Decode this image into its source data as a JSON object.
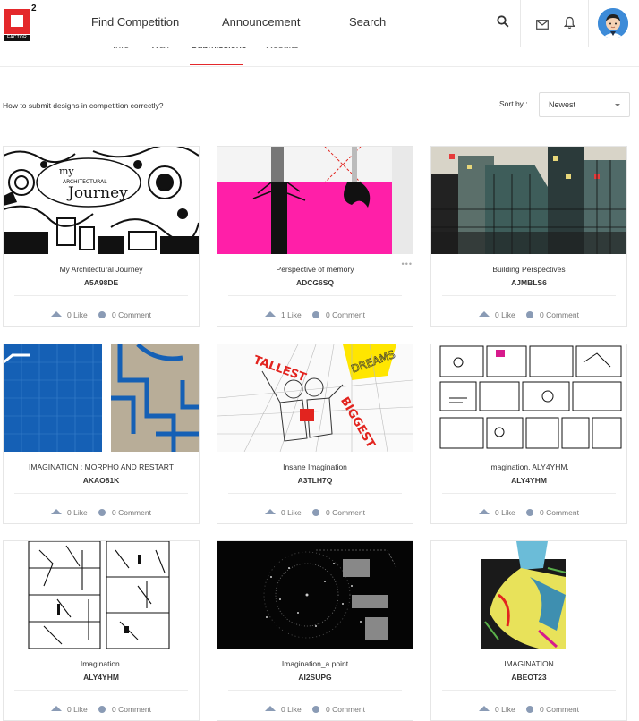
{
  "header": {
    "logo_superscript": "2",
    "logo_text": "FACTOR",
    "nav": [
      "Find Competition",
      "Announcement",
      "Search"
    ]
  },
  "tabs": [
    "Info",
    "Wall",
    "Submissions",
    "Results"
  ],
  "toolbar": {
    "help_link": "How to submit designs in competition correctly?",
    "sort_label": "Sort by :",
    "sort_value": "Newest"
  },
  "cards": [
    {
      "title": "My Architectural Journey",
      "code": "A5A98DE",
      "likes": "0 Like",
      "comments": "0 Comment"
    },
    {
      "title": "Perspective of memory",
      "code": "ADCG6SQ",
      "likes": "1 Like",
      "comments": "0 Comment"
    },
    {
      "title": "Building Perspectives",
      "code": "AJMBLS6",
      "likes": "0 Like",
      "comments": "0 Comment"
    },
    {
      "title": "IMAGINATION : MORPHO AND RESTART",
      "code": "AKAO81K",
      "likes": "0 Like",
      "comments": "0 Comment"
    },
    {
      "title": "Insane Imagination",
      "code": "A3TLH7Q",
      "likes": "0 Like",
      "comments": "0 Comment"
    },
    {
      "title": "Imagination. ALY4YHM.",
      "code": "ALY4YHM",
      "likes": "0 Like",
      "comments": "0 Comment"
    },
    {
      "title": "Imagination.",
      "code": "ALY4YHM",
      "likes": "0 Like",
      "comments": "0 Comment"
    },
    {
      "title": "Imagination_a point",
      "code": "AI2SUPG",
      "likes": "0 Like",
      "comments": "0 Comment"
    },
    {
      "title": "IMAGINATION",
      "code": "ABEOT23",
      "likes": "0 Like",
      "comments": "0 Comment"
    }
  ],
  "artwork_text": {
    "card1": [
      "my",
      "ARCHITECTURAL",
      "Journey"
    ],
    "card5": [
      "TALLEST",
      "BIGGEST",
      "DREAMS"
    ]
  },
  "icons": [
    "search-icon",
    "mail-icon",
    "bell-icon",
    "avatar",
    "like-icon",
    "comment-icon",
    "more-icon"
  ],
  "colors": {
    "brand": "#e4282b",
    "icon_muted": "#8a9bb5"
  }
}
